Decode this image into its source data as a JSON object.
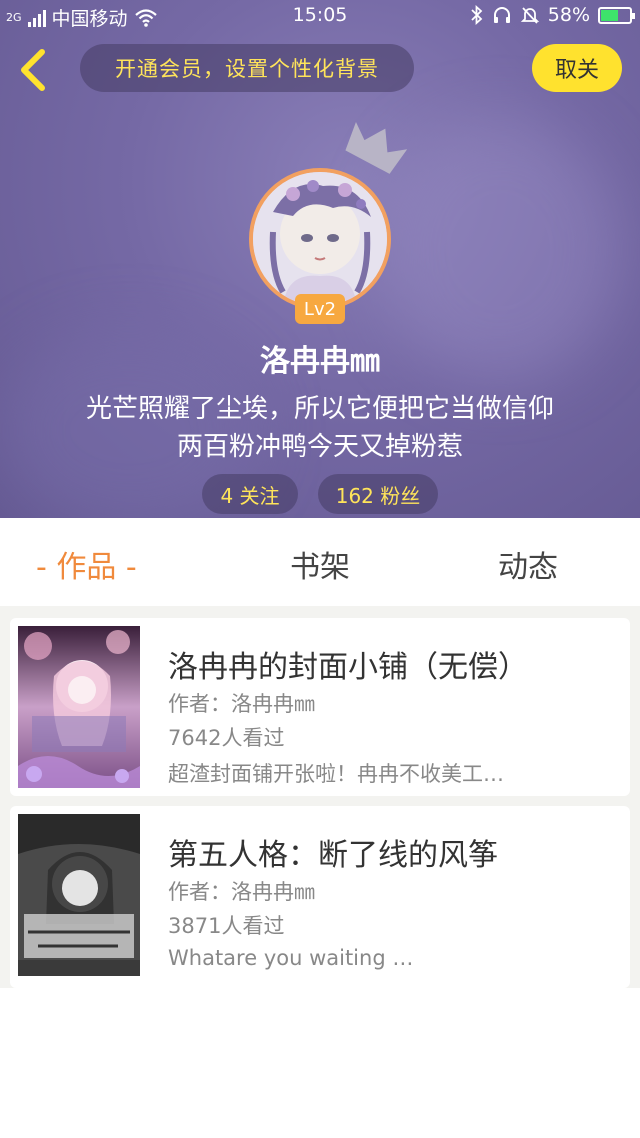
{
  "status_bar": {
    "network_tag": "2G",
    "carrier": "中国移动",
    "time": "15:05",
    "battery_percent": "58%",
    "battery_level": 0.58
  },
  "header": {
    "vip_banner": "开通会员，设置个性化背景",
    "unfollow_label": "取关",
    "level_badge": "Lv2",
    "nickname": "洛冉冉㎜",
    "bio_line1": "光芒照耀了尘埃，所以它便把它当做信仰",
    "bio_line2": "两百粉冲鸭今天又掉粉惹",
    "following": "4 关注",
    "fans": "162 粉丝"
  },
  "tabs": [
    {
      "label": "- 作品 -",
      "active": true
    },
    {
      "label": "书架",
      "active": false
    },
    {
      "label": "动态",
      "active": false
    }
  ],
  "works": [
    {
      "title": "洛冉冉的封面小铺（无偿）",
      "author": "作者：洛冉冉㎜",
      "views": "7642人看过",
      "desc": "超渣封面铺开张啦！冉冉不收美工…"
    },
    {
      "title": "第五人格：断了线的风筝",
      "author": "作者：洛冉冉㎜",
      "views": "3871人看过",
      "desc": "Whatare you waiting …"
    }
  ],
  "colors": {
    "accent": "#f08a3c",
    "header_bg": "#7569a5",
    "highlight_text": "#ffe45a",
    "button_yellow": "#ffe22e"
  }
}
